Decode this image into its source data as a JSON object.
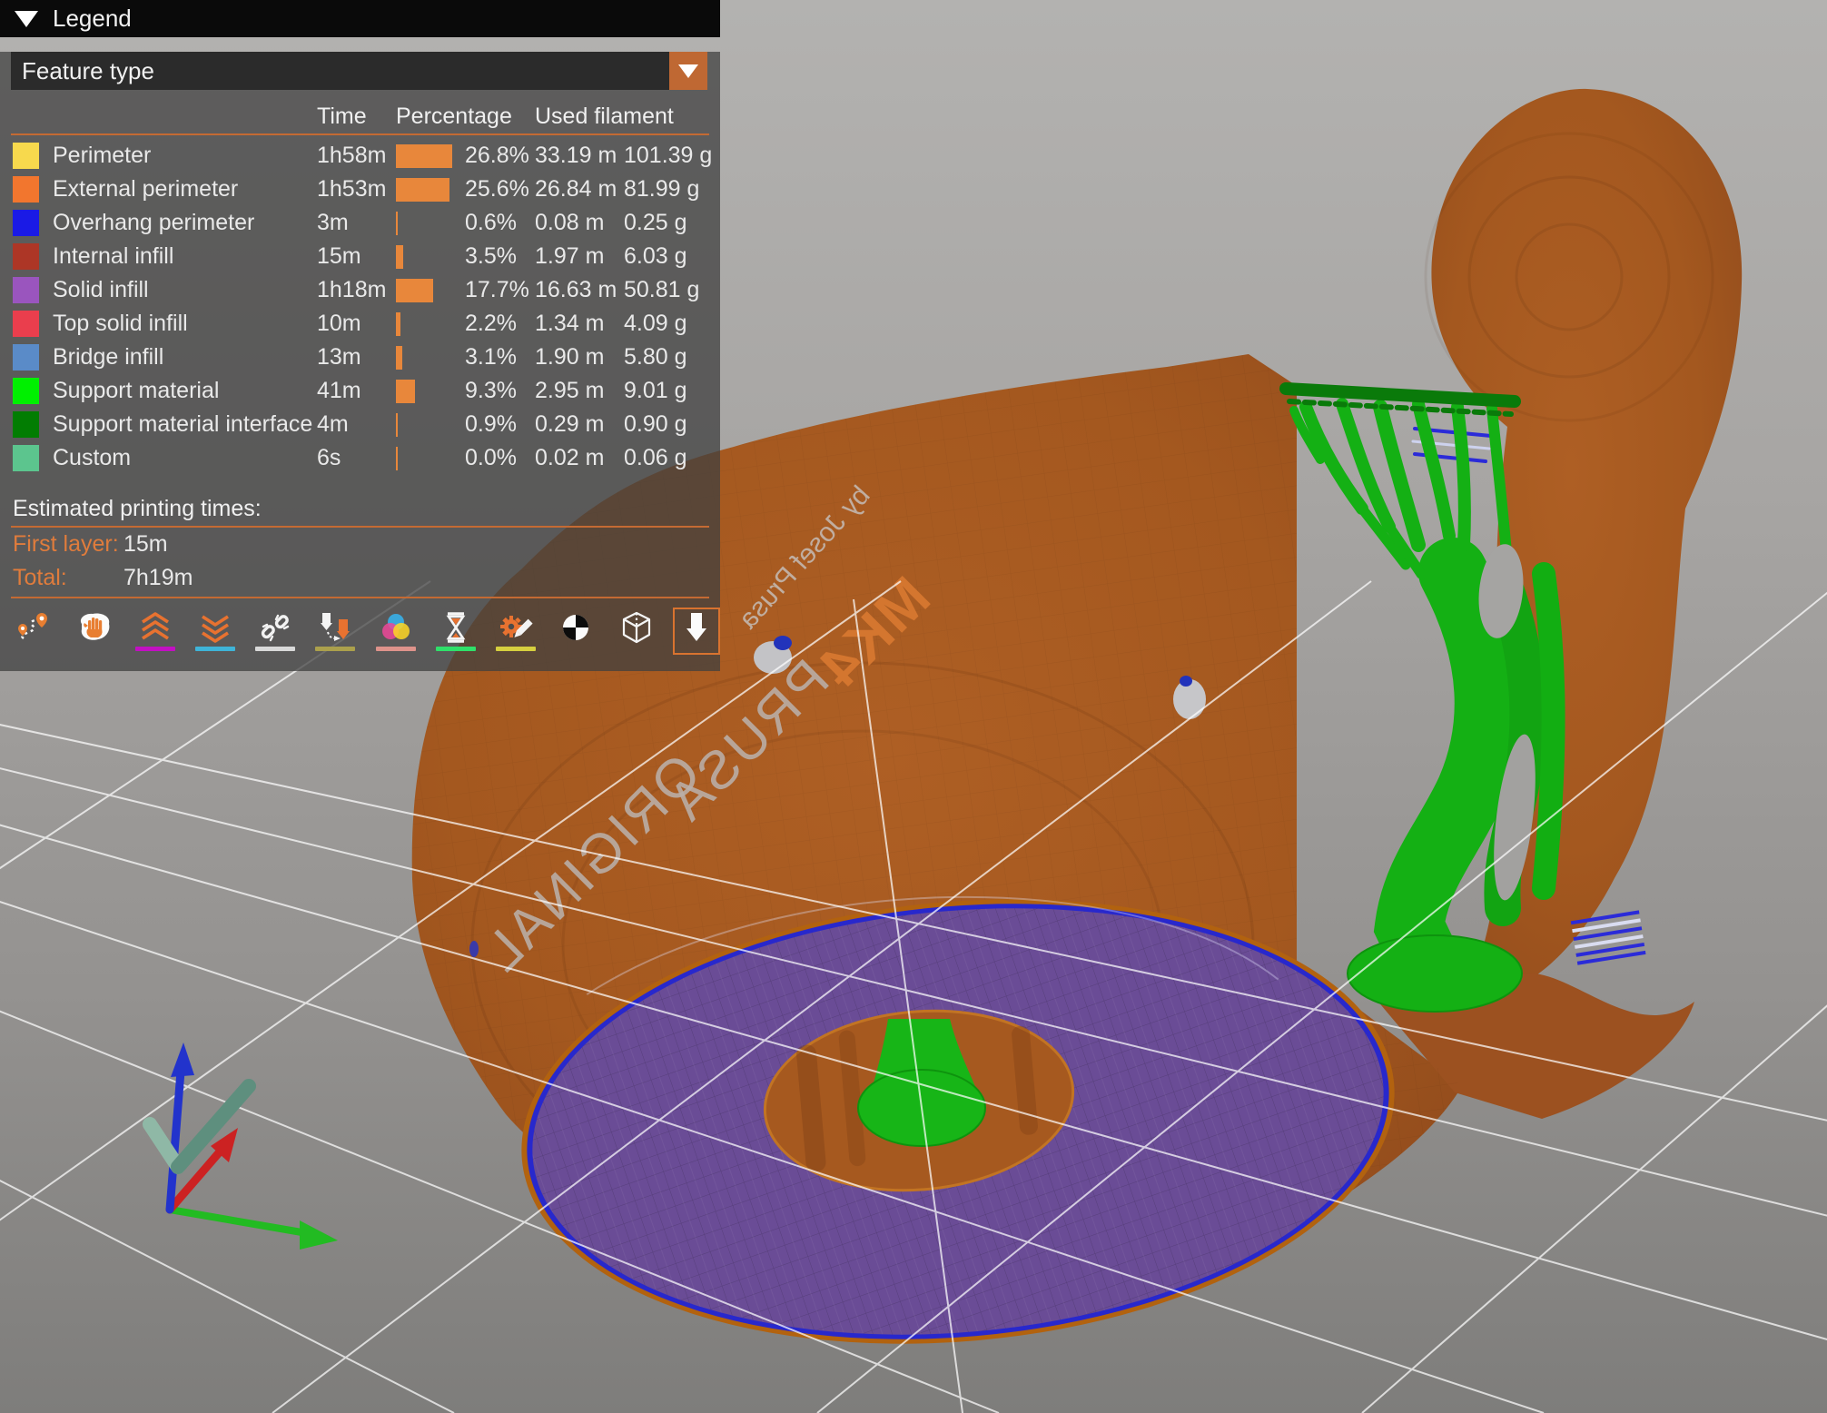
{
  "legend": {
    "title": "Legend",
    "dropdown": {
      "value": "Feature type"
    },
    "columns": {
      "time": "Time",
      "percentage": "Percentage",
      "used_filament": "Used filament"
    },
    "rows": [
      {
        "name": "Perimeter",
        "color": "#f7d94d",
        "time": "1h58m",
        "pct": 26.8,
        "pct_label": "26.8%",
        "length": "33.19 m",
        "weight": "101.39 g"
      },
      {
        "name": "External perimeter",
        "color": "#f2762e",
        "time": "1h53m",
        "pct": 25.6,
        "pct_label": "25.6%",
        "length": "26.84 m",
        "weight": "81.99 g"
      },
      {
        "name": "Overhang perimeter",
        "color": "#1a1ae6",
        "time": "3m",
        "pct": 0.6,
        "pct_label": "0.6%",
        "length": "0.08 m",
        "weight": "0.25 g"
      },
      {
        "name": "Internal infill",
        "color": "#ad3626",
        "time": "15m",
        "pct": 3.5,
        "pct_label": "3.5%",
        "length": "1.97 m",
        "weight": "6.03 g"
      },
      {
        "name": "Solid infill",
        "color": "#9a55be",
        "time": "1h18m",
        "pct": 17.7,
        "pct_label": "17.7%",
        "length": "16.63 m",
        "weight": "50.81 g"
      },
      {
        "name": "Top solid infill",
        "color": "#ea3e4d",
        "time": "10m",
        "pct": 2.2,
        "pct_label": "2.2%",
        "length": "1.34 m",
        "weight": "4.09 g"
      },
      {
        "name": "Bridge infill",
        "color": "#5a8bc8",
        "time": "13m",
        "pct": 3.1,
        "pct_label": "3.1%",
        "length": "1.90 m",
        "weight": "5.80 g"
      },
      {
        "name": "Support material",
        "color": "#00f000",
        "time": "41m",
        "pct": 9.3,
        "pct_label": "9.3%",
        "length": "2.95 m",
        "weight": "9.01 g"
      },
      {
        "name": "Support material interface",
        "color": "#027d02",
        "time": "4m",
        "pct": 0.9,
        "pct_label": "0.9%",
        "length": "0.29 m",
        "weight": "0.90 g"
      },
      {
        "name": "Custom",
        "color": "#5cc58e",
        "time": "6s",
        "pct": 0.0,
        "pct_label": "0.0%",
        "length": "0.02 m",
        "weight": "0.06 g"
      }
    ],
    "bar_color": "#e8873b",
    "estimated_title": "Estimated printing times:",
    "first_layer_label": "First layer:",
    "first_layer_value": "15m",
    "total_label": "Total:",
    "total_value": "7h19m",
    "toolbar_selected": "tool-marker",
    "toolbar": [
      {
        "name": "travel-paths",
        "underline": null
      },
      {
        "name": "wipe-moves",
        "underline": null
      },
      {
        "name": "retractions",
        "underline": "#c210c2"
      },
      {
        "name": "deretractions",
        "underline": "#3fb4d8"
      },
      {
        "name": "seams",
        "underline": "#d9d9d9"
      },
      {
        "name": "tool-changes",
        "underline": "#aba04c"
      },
      {
        "name": "color-changes",
        "underline": "#de938b"
      },
      {
        "name": "pause-prints",
        "underline": "#2fe06a"
      },
      {
        "name": "custom-gcodes",
        "underline": "#d6cf3f"
      },
      {
        "name": "center-of-mass",
        "underline": null
      },
      {
        "name": "shells",
        "underline": null
      },
      {
        "name": "tool-marker",
        "underline": null
      }
    ]
  },
  "scene": {
    "model_text_primary_1": "ORIGINAL",
    "model_text_primary_2": "PRUSA",
    "model_text_accent": "MK4",
    "model_text_secondary": "by Josef Prusa",
    "colors": {
      "body_brown": "#a5591f",
      "solid_infill_purple": "#6a4c96",
      "support_green": "#14b014",
      "support_interface_green": "#0a7a0a",
      "overhang_blue": "#2b2bd8",
      "bed_grid_white": "#ffffff",
      "axis_x_red": "#cc2222",
      "axis_y_green": "#22bb22",
      "axis_z_blue": "#2233cc"
    }
  }
}
